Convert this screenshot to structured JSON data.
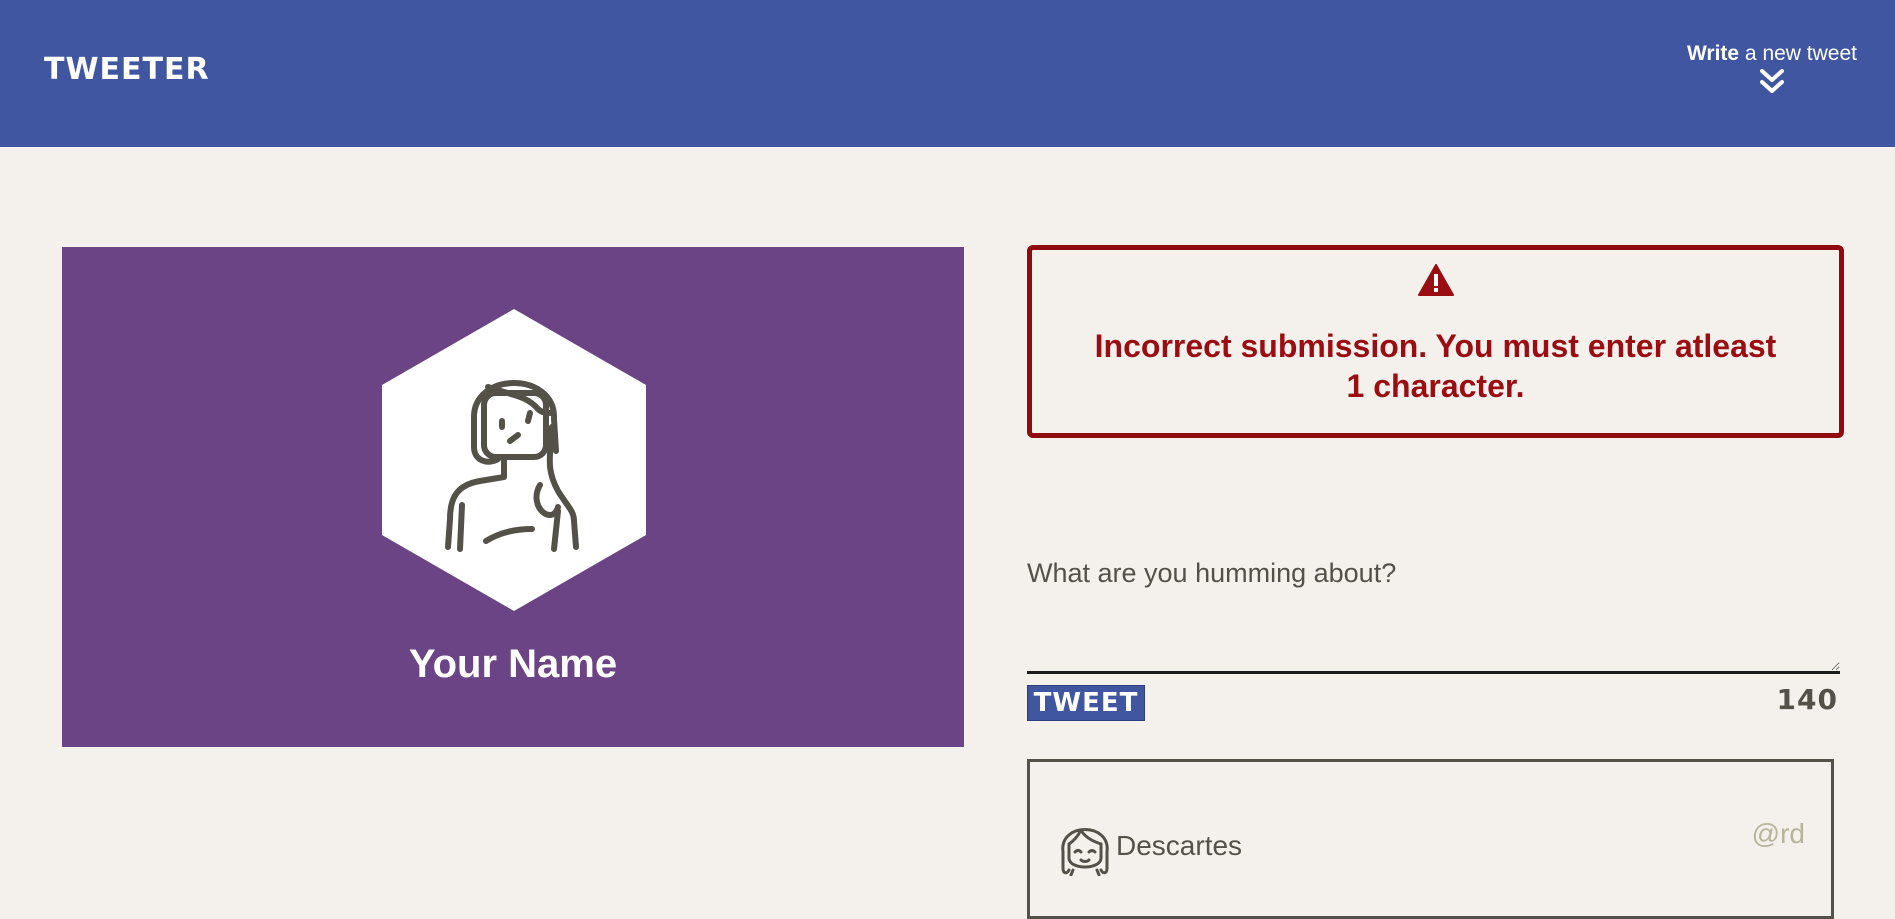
{
  "nav": {
    "brand": "TWEETER",
    "write_bold": "Write",
    "write_rest": " a new tweet",
    "chevron_icon": "double-chevron-down-icon"
  },
  "profile": {
    "name": "Your Name",
    "avatar_icon": "girl-avatar-hexagon",
    "background_color": "#6a4484"
  },
  "error": {
    "icon": "warning-triangle-icon",
    "message": "Incorrect submission. You must enter atleast 1 character.",
    "color": "#9a0e13"
  },
  "composer": {
    "placeholder": "What are you humming about?",
    "value": "",
    "button_label": "TWEET",
    "counter": "140"
  },
  "tweets": [
    {
      "author": "Descartes",
      "handle": "@rd",
      "avatar_icon": "girl-face-avatar"
    }
  ],
  "colors": {
    "navbar": "#4056a1",
    "page_background": "#f4f1ec",
    "text": "#545149"
  }
}
